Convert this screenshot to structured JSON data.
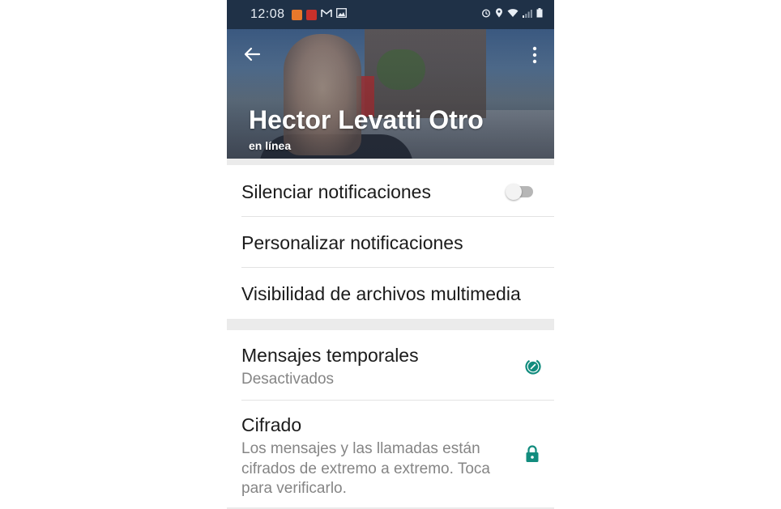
{
  "status_bar": {
    "time": "12:08",
    "left_icons": [
      "app-notification-icon",
      "app-notification-icon",
      "gmail-icon",
      "gallery-icon"
    ],
    "right_icons": [
      "alarm-icon",
      "location-icon",
      "wifi-icon",
      "signal-icon",
      "battery-icon"
    ]
  },
  "header": {
    "contact_name": "Hector Levatti Otro",
    "status": "en línea",
    "back_icon": "arrow-back-icon",
    "menu_icon": "more-vertical-icon"
  },
  "settings": {
    "mute": {
      "label": "Silenciar notificaciones",
      "enabled": false
    },
    "custom_notifications": {
      "label": "Personalizar notificaciones"
    },
    "media_visibility": {
      "label": "Visibilidad de archivos multimedia"
    },
    "disappearing_messages": {
      "label": "Mensajes temporales",
      "value": "Desactivados",
      "icon": "timer-icon"
    },
    "encryption": {
      "label": "Cifrado",
      "description": "Los mensajes y las llamadas están cifrados de extremo a extremo. Toca para verificarlo.",
      "icon": "lock-icon"
    }
  },
  "colors": {
    "accent": "#128C7E",
    "status_bar": "#1f3147",
    "secondary_text": "#858585"
  }
}
